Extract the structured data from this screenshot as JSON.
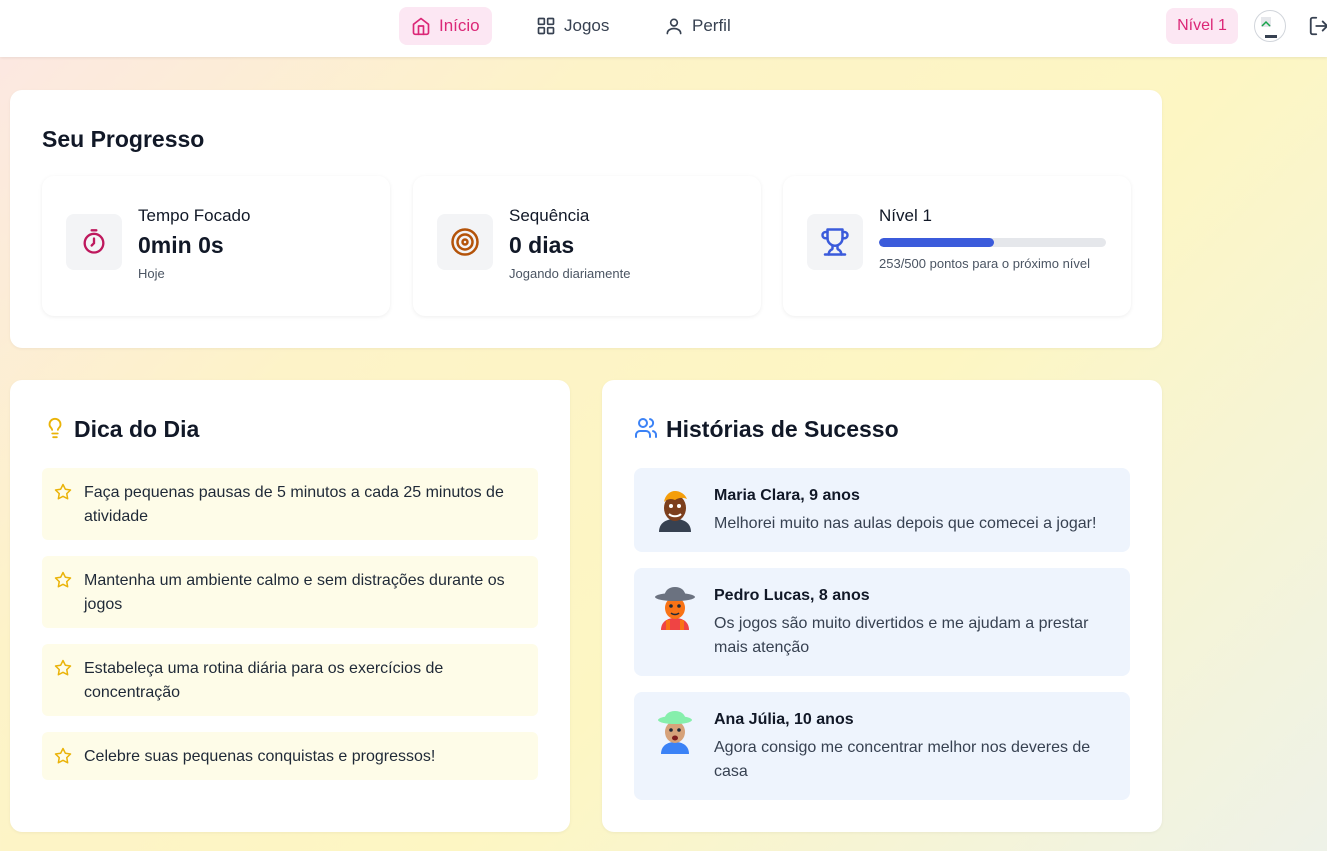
{
  "nav": {
    "items": [
      {
        "label": "Início",
        "icon": "home-icon",
        "active": true
      },
      {
        "label": "Jogos",
        "icon": "grid-icon",
        "active": false
      },
      {
        "label": "Perfil",
        "icon": "user-icon",
        "active": false
      }
    ],
    "level_badge": "Nível 1",
    "avatar_icon": "avatar-icon",
    "logout_icon": "logout-icon"
  },
  "progress": {
    "title": "Seu Progresso",
    "focus": {
      "label": "Tempo Focado",
      "value": "0min 0s",
      "sub": "Hoje",
      "icon": "stopwatch-icon",
      "color": "#be185d"
    },
    "streak": {
      "label": "Sequência",
      "value": "0 dias",
      "sub": "Jogando diariamente",
      "icon": "target-icon",
      "color": "#b45309"
    },
    "level": {
      "label": "Nível 1",
      "points": 253,
      "points_max": 500,
      "sub": "253/500 pontos para o próximo nível",
      "icon": "trophy-icon",
      "color": "#3b5bdb"
    }
  },
  "tips": {
    "title": "Dica do Dia",
    "icon": "lightbulb-icon",
    "items": [
      "Faça pequenas pausas de 5 minutos a cada 25 minutos de atividade",
      "Mantenha um ambiente calmo e sem distrações durante os jogos",
      "Estabeleça uma rotina diária para os exercícios de concentração",
      "Celebre suas pequenas conquistas e progressos!"
    ]
  },
  "stories": {
    "title": "Histórias de Sucesso",
    "icon": "users-icon",
    "items": [
      {
        "name": "Maria Clara, 9 anos",
        "text": "Melhorei muito nas aulas depois que comecei a jogar!"
      },
      {
        "name": "Pedro Lucas, 8 anos",
        "text": "Os jogos são muito divertidos e me ajudam a prestar mais atenção"
      },
      {
        "name": "Ana Júlia, 10 anos",
        "text": "Agora consigo me concentrar melhor nos deveres de casa"
      }
    ]
  },
  "colors": {
    "accent_pink": "#db2777",
    "accent_blue": "#3b5bdb",
    "tip_bg": "#fefce8",
    "story_bg": "#eef4fd"
  }
}
